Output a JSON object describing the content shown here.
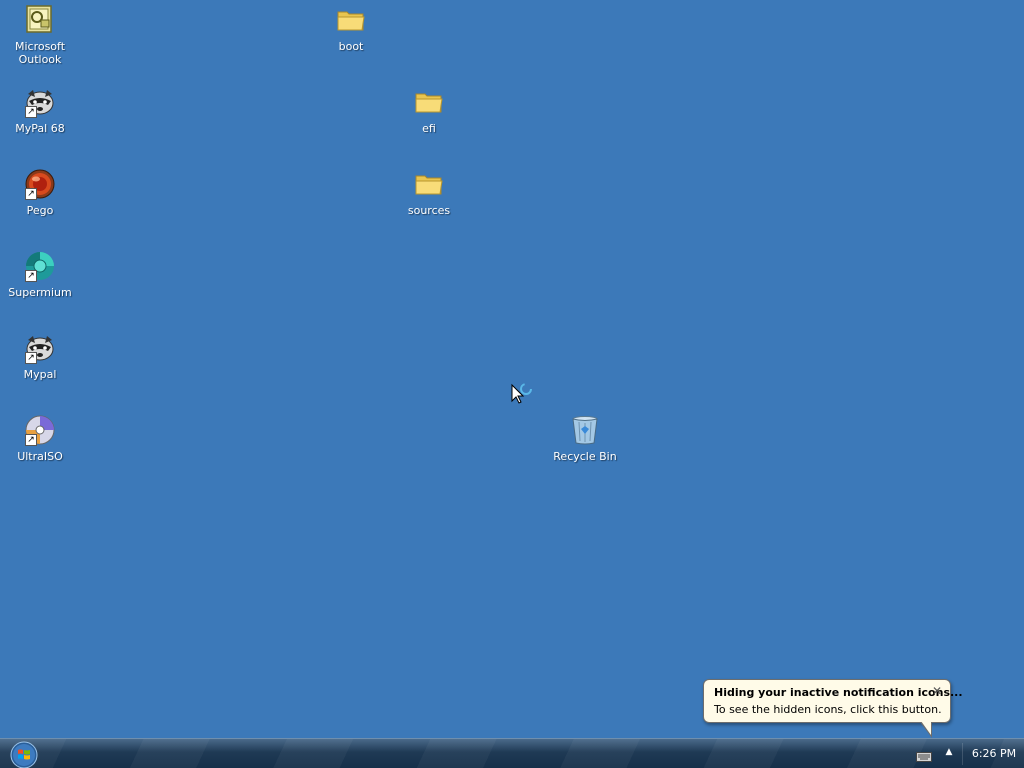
{
  "desktop": {
    "icons": [
      {
        "label_line1": "Microsoft",
        "label_line2": "Outlook",
        "icon": "outlook-icon"
      },
      {
        "label": "MyPal 68",
        "icon": "mypal-raccoon-icon"
      },
      {
        "label": "Pego",
        "icon": "pego-icon"
      },
      {
        "label": "Supermium",
        "icon": "supermium-icon"
      },
      {
        "label": "Mypal",
        "icon": "mypal-raccoon-icon"
      },
      {
        "label": "UltraISO",
        "icon": "ultraiso-disc-icon"
      },
      {
        "label": "boot",
        "icon": "folder-icon"
      },
      {
        "label": "efi",
        "icon": "folder-icon"
      },
      {
        "label": "sources",
        "icon": "folder-icon"
      },
      {
        "label": "Recycle Bin",
        "icon": "recycle-bin-icon"
      }
    ]
  },
  "balloon": {
    "title": "Hiding your inactive notification icons...",
    "text": "To see the hidden icons, click this button.",
    "close_glyph": "✕"
  },
  "taskbar": {
    "start_icon": "windows-start-orb",
    "tray_chevron": "▲",
    "clock": "6:26 PM"
  },
  "colors": {
    "desktop_background": "#3c79b9",
    "taskbar": "#1f3a55",
    "balloon_background": "#fffbe8"
  }
}
